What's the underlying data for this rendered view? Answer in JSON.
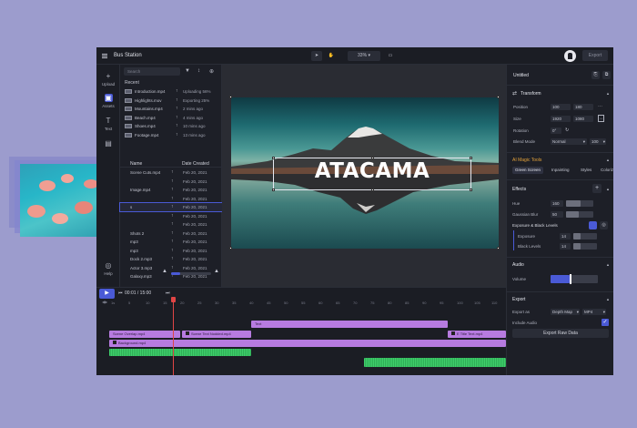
{
  "app": {
    "title": "Bus Station",
    "zoom": "33%",
    "export_label": "Export"
  },
  "nav": {
    "upload": "Upload",
    "assets": "Assets",
    "text": "Text",
    "help": "Help"
  },
  "assets": {
    "search_placeholder": "Search",
    "recent_label": "Recent",
    "recent": [
      {
        "name": "Introduction.mp4",
        "status": "Uploading 56%"
      },
      {
        "name": "Highlights.mov",
        "status": "Exporting 25%"
      },
      {
        "name": "Mountains.mp4",
        "status": "2 mins ago"
      },
      {
        "name": "Beach.mp4",
        "status": "4 mins ago"
      },
      {
        "name": "Shoes.mp4",
        "status": "10 mins ago"
      },
      {
        "name": "Footage.mp4",
        "status": "13 mins ago"
      }
    ],
    "col_name": "Name",
    "col_date": "Date Created",
    "library": [
      {
        "name": "Scene Cuts.mp4",
        "date": "Feb 20, 2021"
      },
      {
        "name": "",
        "date": "Feb 20, 2021"
      },
      {
        "name": "Image.mp4",
        "date": "Feb 20, 2021"
      },
      {
        "name": "",
        "date": "Feb 20, 2021"
      },
      {
        "name": "s",
        "date": "Feb 20, 2021"
      },
      {
        "name": "",
        "date": "Feb 20, 2021"
      },
      {
        "name": "",
        "date": "Feb 20, 2021"
      },
      {
        "name": "Shots 2",
        "date": "Feb 20, 2021"
      },
      {
        "name": "mp3",
        "date": "Feb 20, 2021"
      },
      {
        "name": "mp3",
        "date": "Feb 20, 2021"
      },
      {
        "name": "Dock 2.mp3",
        "date": "Feb 20, 2021"
      },
      {
        "name": "Actor 3.mp3",
        "date": "Feb 20, 2021"
      },
      {
        "name": "Galaxy.mp3",
        "date": "Feb 20, 2021"
      }
    ]
  },
  "canvas": {
    "title_text": "ATACAMA"
  },
  "props": {
    "panel_title": "Untitled",
    "transform": "Transform",
    "position_label": "Position",
    "position_x": "100",
    "position_y": "180",
    "size_label": "Size",
    "size_w": "1920",
    "size_h": "1080",
    "rotation_label": "Rotation",
    "rotation": "0°",
    "blend_label": "Blend Mode",
    "blend_value": "Normal",
    "blend_opacity": "100",
    "magic_tools": "AI Magic Tools",
    "magic_tags": [
      "Green Screen",
      "Inpainting",
      "Styles",
      "Colorize"
    ],
    "effects": "Effects",
    "hue_label": "Hue",
    "hue_value": "160",
    "gaussian_label": "Gaussian Blur",
    "gaussian_value": "50",
    "exposure_group": "Exposure & Black Levels",
    "exposure_label": "Exposure",
    "exposure_value": "14",
    "black_label": "Black Levels",
    "black_value": "14",
    "audio": "Audio",
    "volume_label": "Volume",
    "volume_level": 0.4,
    "export": "Export",
    "export_as_label": "Export as",
    "export_as_value": "Depth Map",
    "export_format": "MP4",
    "include_audio": "Include Audio",
    "export_raw": "Export Raw Data",
    "accent": "#4a5ad6",
    "magic_color": "#e4a23a"
  },
  "timeline": {
    "timecode": "00:01 / 15:00",
    "ticks": [
      "1s",
      "5",
      "10",
      "15",
      "20",
      "25",
      "30",
      "35",
      "40",
      "45",
      "50",
      "55",
      "60",
      "65",
      "70",
      "75",
      "80",
      "85",
      "90",
      "95",
      "100",
      "105",
      "110"
    ],
    "tracks": {
      "text_clip": "Text",
      "scene_overlap": "Scene Overlap.mp4",
      "scene_text": "Scene Text Nodded.mp4",
      "title_text": "E Title Text.mp4",
      "background": "Background.mp4"
    },
    "track_color": "#b77be0",
    "audio_color": "#3fcf6b",
    "playhead_color": "#e04545"
  }
}
